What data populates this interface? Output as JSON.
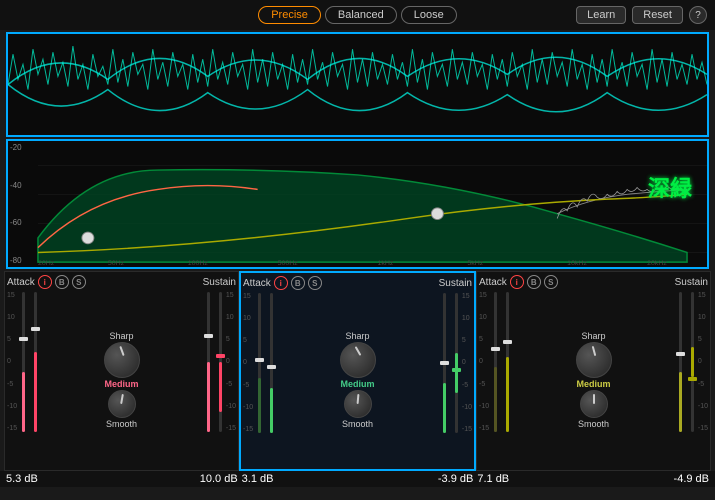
{
  "topbar": {
    "modes": [
      {
        "label": "Precise",
        "active": true
      },
      {
        "label": "Balanced",
        "active": false
      },
      {
        "label": "Loose",
        "active": false
      }
    ],
    "learn_label": "Learn",
    "reset_label": "Reset",
    "help_label": "?"
  },
  "annotation": {
    "kanji": "深緑",
    "arrow_text": "↗"
  },
  "channels": [
    {
      "id": "ch1",
      "attack_label": "Attack",
      "sustain_label": "Sustain",
      "icons": [
        "i",
        "B",
        "S"
      ],
      "sharp_label": "Sharp",
      "medium_label": "Medium",
      "medium_color": "pink",
      "smooth_label": "Smooth",
      "db_left": "5.3 dB",
      "db_right": "10.0 dB",
      "highlighted": false
    },
    {
      "id": "ch2",
      "attack_label": "Attack",
      "sustain_label": "Sustain",
      "icons": [
        "i",
        "B",
        "S"
      ],
      "sharp_label": "Sharp",
      "medium_label": "Medium",
      "medium_color": "green",
      "smooth_label": "Smooth",
      "db_left": "3.1 dB",
      "db_right": "-3.9 dB",
      "highlighted": true
    },
    {
      "id": "ch3",
      "attack_label": "Attack",
      "sustain_label": "Sustain",
      "icons": [
        "i",
        "B",
        "S"
      ],
      "sharp_label": "Sharp",
      "medium_label": "Medium",
      "medium_color": "yellow",
      "smooth_label": "Smooth",
      "db_left": "7.1 dB",
      "db_right": "-4.9 dB",
      "highlighted": false
    }
  ],
  "freq_labels": [
    "-20",
    "-40",
    "-60",
    "-80"
  ],
  "scale_values": [
    "15",
    "10",
    "5",
    "0",
    "-5",
    "-10",
    "-15"
  ]
}
